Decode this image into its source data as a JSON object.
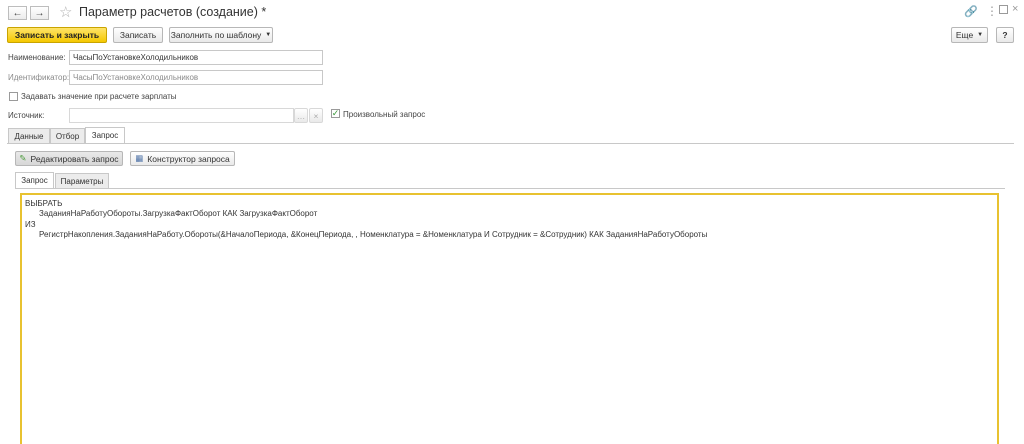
{
  "window": {
    "title": "Параметр расчетов (создание) *"
  },
  "toolbar": {
    "save_close_label": "Записать и закрыть",
    "save_label": "Записать",
    "fill_template_label": "Заполнить по шаблону",
    "more_label": "Еще",
    "help_label": "?"
  },
  "form": {
    "name_label": "Наименование:",
    "name_value": "ЧасыПоУстановкеХолодильников",
    "id_label": "Идентификатор:",
    "id_value": "ЧасыПоУстановкеХолодильников",
    "set_value_checkbox_label": "Задавать значение при расчете зарплаты",
    "source_label": "Источник:",
    "source_value": "",
    "arbitrary_query_label": "Произвольный запрос"
  },
  "tabs": [
    {
      "label": "Данные"
    },
    {
      "label": "Отбор"
    },
    {
      "label": "Запрос"
    }
  ],
  "query_actions": {
    "edit_query_label": "Редактировать запрос",
    "query_builder_label": "Конструктор запроса"
  },
  "inner_tabs": [
    {
      "label": "Запрос"
    },
    {
      "label": "Параметры"
    }
  ],
  "query_text": {
    "line1": "ВЫБРАТЬ",
    "line2": "ЗаданияНаРаботуОбороты.ЗагрузкаФактОборот КАК ЗагрузкаФактОборот",
    "line3": "ИЗ",
    "line4": "РегистрНакопления.ЗаданияНаРаботу.Обороты(&НачалоПериода, &КонецПериода, , Номенклатура = &Номенклатура И Сотрудник = &Сотрудник) КАК ЗаданияНаРаботуОбороты"
  },
  "colors": {
    "accent_yellow": "#f5c800",
    "editor_border": "#e8c230",
    "checkbox_green": "#3a9a3a"
  }
}
